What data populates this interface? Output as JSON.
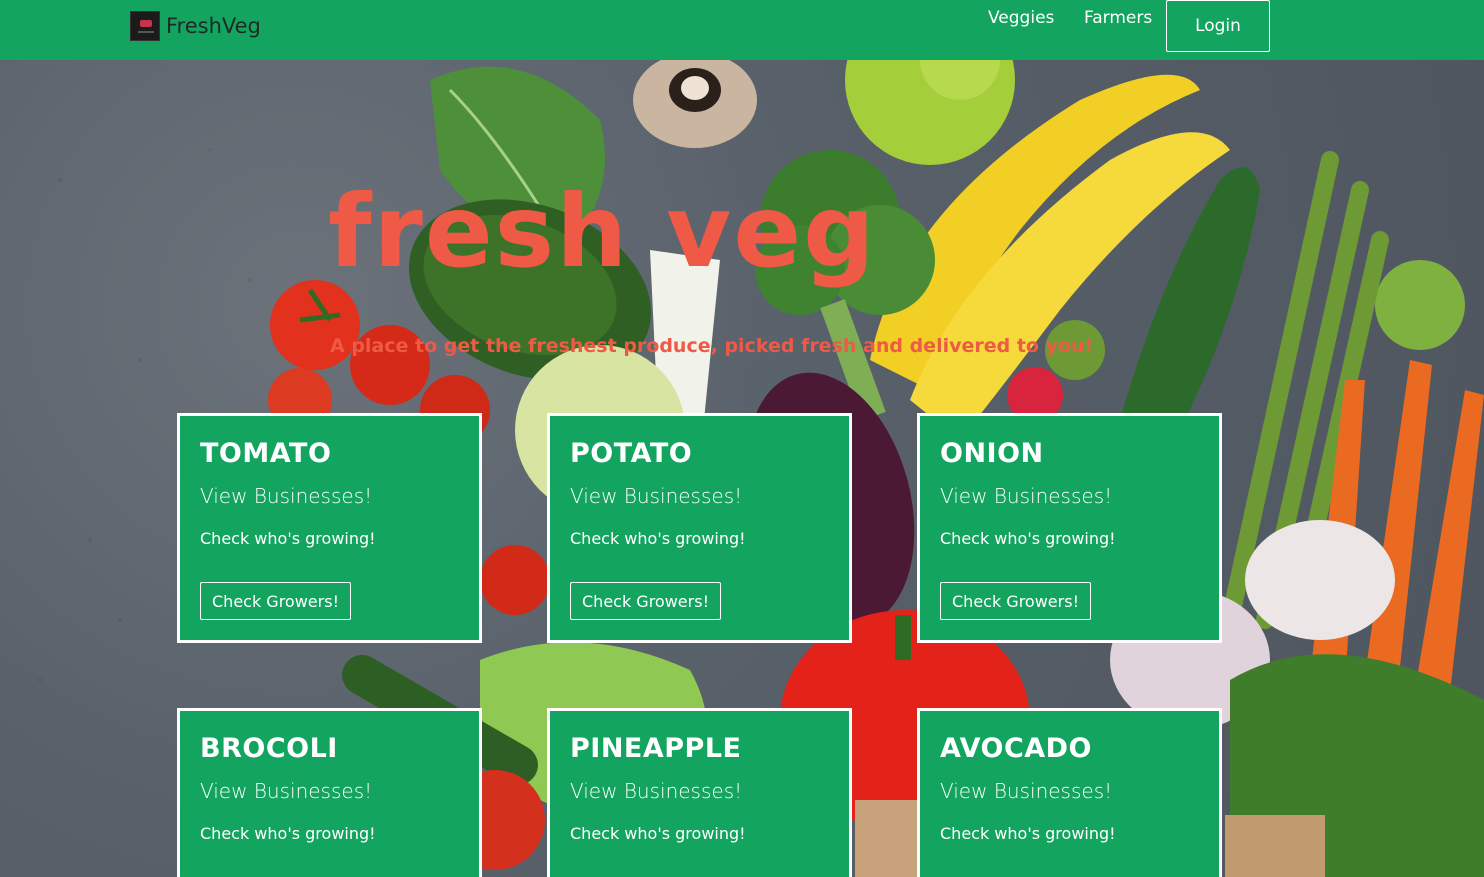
{
  "navbar": {
    "brand": "FreshVeg",
    "links": [
      "Veggies",
      "Farmers"
    ],
    "login": "Login"
  },
  "hero": {
    "title": "fresh veg",
    "subtitle": "A place to get the freshest produce, picked fresh and delivered to you!"
  },
  "cards": [
    {
      "title": "TOMATO",
      "subtitle": "View Businesses!",
      "text": "Check who's growing!",
      "button": "Check Growers!"
    },
    {
      "title": "POTATO",
      "subtitle": "View Businesses!",
      "text": "Check who's growing!",
      "button": "Check Growers!"
    },
    {
      "title": "ONION",
      "subtitle": "View Businesses!",
      "text": "Check who's growing!",
      "button": "Check Growers!"
    },
    {
      "title": "BROCOLI",
      "subtitle": "View Businesses!",
      "text": "Check who's growing!"
    },
    {
      "title": "PINEAPPLE",
      "subtitle": "View Businesses!",
      "text": "Check who's growing!"
    },
    {
      "title": "AVOCADO",
      "subtitle": "View Businesses!",
      "text": "Check who's growing!"
    }
  ],
  "colors": {
    "primary_green": "#13a560",
    "accent_coral": "#ee5a45",
    "card_border": "#ffffff"
  },
  "icons": {
    "brand_logo": "freshveg-logo-icon"
  }
}
